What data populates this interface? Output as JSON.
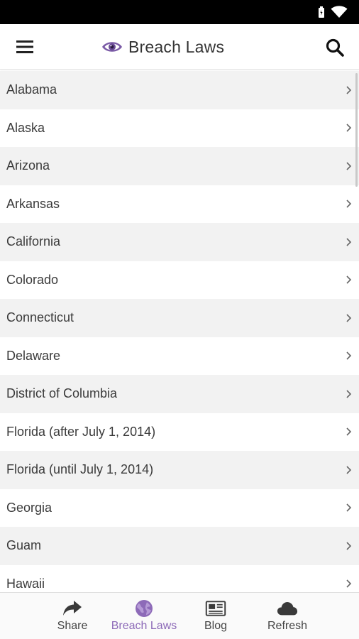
{
  "header": {
    "title": "Breach Laws"
  },
  "states": [
    "Alabama",
    "Alaska",
    "Arizona",
    "Arkansas",
    "California",
    "Colorado",
    "Connecticut",
    "Delaware",
    "District of Columbia",
    "Florida (after July 1, 2014)",
    "Florida (until July 1, 2014)",
    "Georgia",
    "Guam",
    "Hawaii"
  ],
  "nav": {
    "share": "Share",
    "breach_laws": "Breach Laws",
    "blog": "Blog",
    "refresh": "Refresh"
  },
  "colors": {
    "accent": "#8d6ab8",
    "row_alt": "#f2f2f2"
  },
  "icons": {
    "menu": "hamburger-icon",
    "search": "search-icon",
    "logo": "eye-icon"
  }
}
